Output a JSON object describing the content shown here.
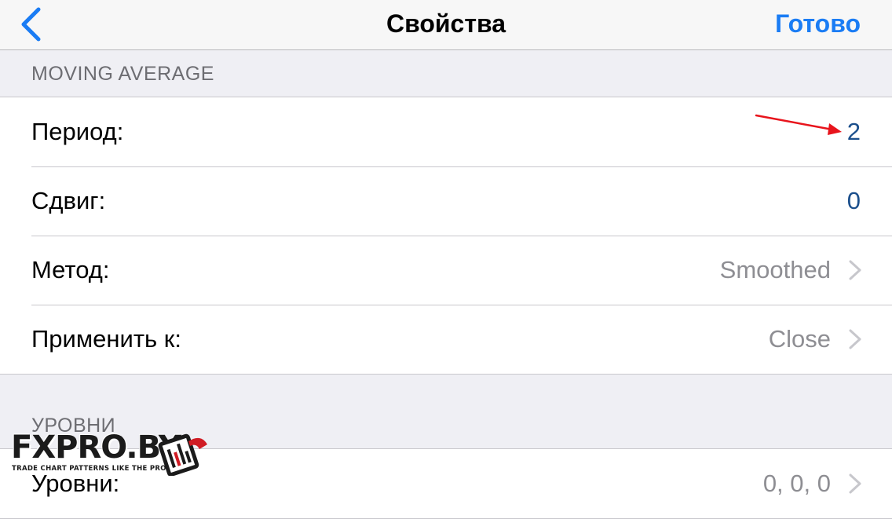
{
  "nav": {
    "title": "Свойства",
    "back_icon": "chevron-left-icon",
    "done_label": "Готово"
  },
  "sections": [
    {
      "header": "MOVING AVERAGE",
      "rows": [
        {
          "label": "Период:",
          "value": "2",
          "kind": "editable"
        },
        {
          "label": "Сдвиг:",
          "value": "0",
          "kind": "editable"
        },
        {
          "label": "Метод:",
          "value": "Smoothed",
          "kind": "disclosure"
        },
        {
          "label": "Применить к:",
          "value": "Close",
          "kind": "disclosure"
        }
      ]
    },
    {
      "header": "УРОВНИ",
      "rows": [
        {
          "label": "Уровни:",
          "value": "0, 0, 0",
          "kind": "disclosure"
        }
      ]
    }
  ],
  "watermark": {
    "title": "FXPRO.BY",
    "subtitle": "TRADE CHART PATTERNS LIKE THE PROS"
  },
  "logo": {
    "title": "FXPRO.BY",
    "subtitle": "TRADE CHART PATTERNS LIKE THE PROS"
  },
  "colors": {
    "accent": "#1a7cf4",
    "value": "#1b4f8c",
    "detail": "#8e8e93",
    "annotation_arrow": "#e8141c",
    "background": "#efeff4"
  }
}
